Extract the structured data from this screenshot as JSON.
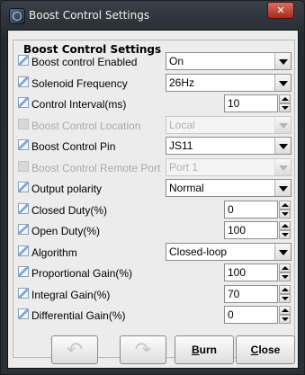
{
  "window": {
    "title": "Boost Control Settings",
    "minimize_glyph": "–",
    "maximize_glyph": "□",
    "close_glyph": "✕"
  },
  "group": {
    "title": "Boost Control Settings"
  },
  "fields": [
    {
      "label": "Boost control Enabled",
      "type": "combo",
      "value": "On",
      "enabled": true
    },
    {
      "label": "Solenoid Frequency",
      "type": "combo",
      "value": "26Hz",
      "enabled": true
    },
    {
      "label": "Control Interval(ms)",
      "type": "spinner",
      "value": "10",
      "enabled": true
    },
    {
      "label": "Boost Control Location",
      "type": "combo",
      "value": "Local",
      "enabled": false
    },
    {
      "label": "Boost Control Pin",
      "type": "combo",
      "value": "JS11",
      "enabled": true
    },
    {
      "label": "Boost Control Remote Port",
      "type": "combo",
      "value": "Port 1",
      "enabled": false
    },
    {
      "label": "Output polarity",
      "type": "combo",
      "value": "Normal",
      "enabled": true
    },
    {
      "label": "Closed Duty(%)",
      "type": "spinner",
      "value": "0",
      "enabled": true
    },
    {
      "label": "Open Duty(%)",
      "type": "spinner",
      "value": "100",
      "enabled": true
    },
    {
      "label": "Algorithm",
      "type": "combo",
      "value": "Closed-loop",
      "enabled": true
    },
    {
      "label": "Proportional Gain(%)",
      "type": "spinner",
      "value": "100",
      "enabled": true
    },
    {
      "label": "Integral Gain(%)",
      "type": "spinner",
      "value": "70",
      "enabled": true
    },
    {
      "label": "Differential Gain(%)",
      "type": "spinner",
      "value": "0",
      "enabled": true
    }
  ],
  "buttons": {
    "undo_icon": "undo-icon",
    "redo_icon": "redo-icon",
    "burn_label_first": "B",
    "burn_label_rest": "urn",
    "close_label_first": "C",
    "close_label_rest": "lose"
  }
}
